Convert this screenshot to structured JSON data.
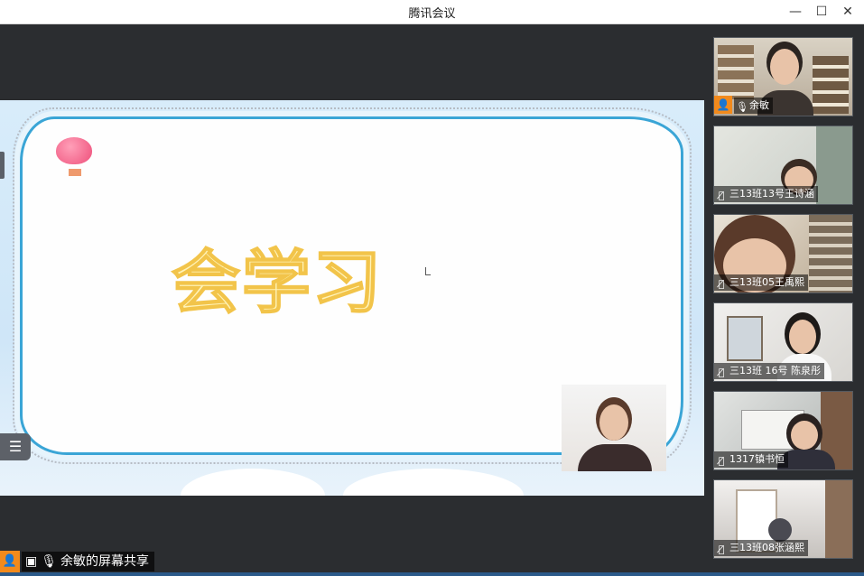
{
  "window": {
    "title": "腾讯会议"
  },
  "window_controls": {
    "minimize": "—",
    "maximize": "☐",
    "close": "✕"
  },
  "slide": {
    "title": "会学习"
  },
  "share": {
    "label": "余敏的屏幕共享"
  },
  "participants": [
    {
      "name": "余敏",
      "mic": "on",
      "host": true
    },
    {
      "name": "三13班13号王诗涵",
      "mic": "off"
    },
    {
      "name": "三13班05王禹熙",
      "mic": "off"
    },
    {
      "name": "三13班  16号  陈泉彤",
      "mic": "off"
    },
    {
      "name": "1317镇书恒",
      "mic": "off"
    },
    {
      "name": "三13班08张涵熙",
      "mic": "off"
    }
  ]
}
